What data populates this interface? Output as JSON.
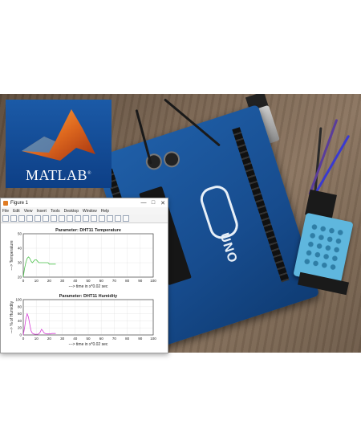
{
  "colors": {
    "temperature_line": "#4cc24c",
    "humidity_line": "#d63fd6",
    "matlab_blue": "#1b5aa7",
    "sensor_blue": "#5fb7de"
  },
  "logo": {
    "wordmark": "MATLAB",
    "trademark": "®"
  },
  "window": {
    "title": "Figure 1",
    "controls": [
      "—",
      "□",
      "✕"
    ],
    "menu": [
      "File",
      "Edit",
      "View",
      "Insert",
      "Tools",
      "Desktop",
      "Window",
      "Help"
    ],
    "toolbar_icons": [
      "new-icon",
      "open-icon",
      "save-icon",
      "print-icon",
      "pointer-icon",
      "zoom-in-icon",
      "zoom-out-icon",
      "pan-icon",
      "rotate-icon",
      "datacursor-icon",
      "brush-icon",
      "link-icon",
      "colorbar-icon",
      "legend-icon",
      "hide-icon",
      "dock-icon"
    ]
  },
  "chart_data": [
    {
      "type": "line",
      "title": "Parameter: DHT11 Temperature",
      "xlabel": "---> time in x*0.02 sec",
      "ylabel": "---> Temperature",
      "xlim": [
        0,
        100
      ],
      "ylim": [
        20,
        50
      ],
      "xticks": [
        "0",
        "10",
        "20",
        "30",
        "40",
        "50",
        "60",
        "70",
        "80",
        "90",
        "100"
      ],
      "yticks": [
        "20",
        "30",
        "40",
        "50"
      ],
      "grid": true,
      "series": [
        {
          "x": [
            0,
            1,
            2,
            3,
            4,
            5,
            6,
            7,
            8,
            9,
            10,
            11,
            12,
            13,
            14,
            15,
            16,
            17,
            18,
            19,
            20,
            21,
            22,
            23,
            24,
            25
          ],
          "y": [
            20,
            26,
            30,
            33,
            34,
            33,
            31,
            30,
            31,
            32,
            32,
            31,
            30,
            30,
            30,
            30,
            30,
            30,
            30,
            30,
            29,
            29,
            29,
            29,
            29,
            29
          ]
        }
      ]
    },
    {
      "type": "line",
      "title": "Parameter: DHT11 Humidity",
      "xlabel": "---> time in x*0.02 sec",
      "ylabel": "---> % of Humidity",
      "xlim": [
        0,
        100
      ],
      "ylim": [
        0,
        100
      ],
      "xticks": [
        "0",
        "10",
        "20",
        "30",
        "40",
        "50",
        "60",
        "70",
        "80",
        "90",
        "100"
      ],
      "yticks": [
        "0",
        "20",
        "40",
        "60",
        "80",
        "100"
      ],
      "grid": true,
      "series": [
        {
          "x": [
            0,
            1,
            2,
            3,
            4,
            5,
            6,
            7,
            8,
            9,
            10,
            11,
            12,
            13,
            14,
            15,
            16,
            17,
            18,
            19,
            20,
            21,
            22,
            23,
            24,
            25
          ],
          "y": [
            0,
            20,
            45,
            60,
            50,
            30,
            12,
            5,
            3,
            2,
            2,
            2,
            3,
            8,
            16,
            12,
            6,
            4,
            3,
            3,
            3,
            3,
            4,
            4,
            4,
            4
          ]
        }
      ]
    }
  ]
}
